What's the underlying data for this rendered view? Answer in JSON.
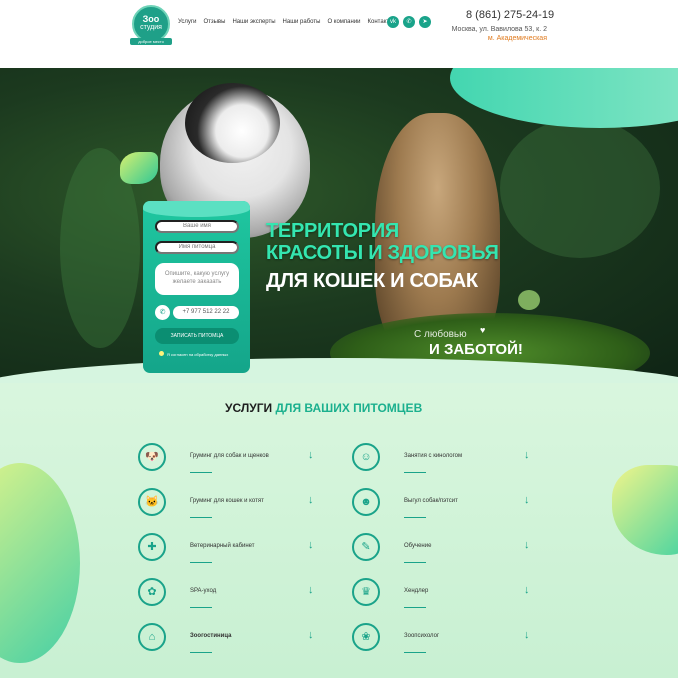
{
  "header": {
    "logo_text": "Зоо",
    "logo_sub": "студия",
    "logo_tag": "доброе место",
    "nav": [
      "Услуги",
      "Отзывы",
      "Наши эксперты",
      "Наши работы",
      "О компании",
      "Контакты"
    ],
    "socials": [
      "vk-icon",
      "whatsapp-icon",
      "telegram-icon"
    ],
    "phone": "8 (861) 275-24-19",
    "address": "Москва, ул. Вавилова 53, к. 2",
    "metro": "м. Академическая"
  },
  "hero": {
    "title_line1": "ТЕРРИТОРИЯ",
    "title_line2": "КРАСОТЫ И ЗДОРОВЬЯ",
    "title_line3": "ДЛЯ КОШЕК И СОБАК",
    "care_small": "С любовью",
    "care_big": "И ЗАБОТОЙ!"
  },
  "form": {
    "name_placeholder": "Ваше имя",
    "pet_placeholder": "Имя питомца",
    "service_placeholder": "Опишите, какую услугу желаете заказать",
    "phone_value": "+7 977 512 22 22",
    "submit_label": "ЗАПИСАТЬ ПИТОМЦА",
    "agree_text": "Я согласен на обработку данных"
  },
  "services": {
    "title_black": "УСЛУГИ",
    "title_green": "ДЛЯ ВАШИХ ПИТОМЦЕВ",
    "left": [
      {
        "label": "Груминг для собак и щенков",
        "icon": "dog-icon"
      },
      {
        "label": "Груминг для кошек и котят",
        "icon": "cat-icon"
      },
      {
        "label": "Ветеринарный кабинет",
        "icon": "vet-icon"
      },
      {
        "label": "SPA-уход",
        "icon": "spa-icon"
      },
      {
        "label": "Зоогостиница",
        "icon": "hotel-icon"
      }
    ],
    "right": [
      {
        "label": "Занятия с кинологом",
        "icon": "trainer-icon"
      },
      {
        "label": "Выгул собак/пэтсит",
        "icon": "walk-icon"
      },
      {
        "label": "Обучение",
        "icon": "education-icon"
      },
      {
        "label": "Хендлер",
        "icon": "handler-icon"
      },
      {
        "label": "Зоопсихолог",
        "icon": "psychologist-icon"
      }
    ]
  }
}
